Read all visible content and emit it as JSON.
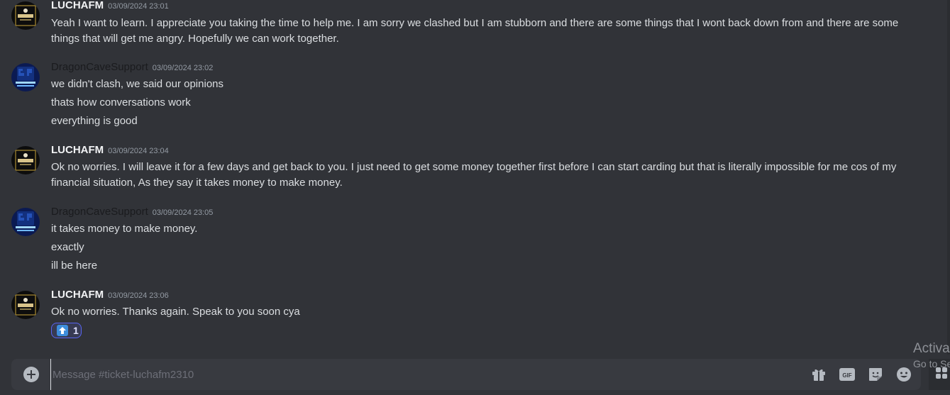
{
  "colors": {
    "background": "#313338",
    "username": "#f2f3f5",
    "support_username": "#1a1b1e",
    "timestamp": "#949ba4",
    "message_text": "#dbdee1",
    "reaction_border": "#5865f2",
    "composer_bg": "#383a40"
  },
  "messages": [
    {
      "author": "LUCHAFM",
      "avatar_icon": "luchafm-logo-avatar",
      "timestamp": "03/09/2024 23:01",
      "lines": [
        "Yeah I want to learn. I appreciate you taking the time to help me. I am sorry we clashed but I am stubborn and there are some things that I wont back down from and there are some things that will get me angry. Hopefully we can work together."
      ]
    },
    {
      "author": "DragonCaveSupport",
      "avatar_icon": "lockbit-ransomware-avatar",
      "timestamp": "03/09/2024 23:02",
      "lines": [
        "we didn't clash, we said our opinions",
        "thats how conversations work",
        "everything is good"
      ]
    },
    {
      "author": "LUCHAFM",
      "avatar_icon": "luchafm-logo-avatar",
      "timestamp": "03/09/2024 23:04",
      "lines": [
        "Ok no worries. I will leave it for a few days and get back to you.  I just need to get some money together first before I can start carding but that is literally impossible for me cos of my financial situation, As they say it takes money to make money."
      ]
    },
    {
      "author": "DragonCaveSupport",
      "avatar_icon": "lockbit-ransomware-avatar",
      "timestamp": "03/09/2024 23:05",
      "lines": [
        "it takes money to make money.",
        "exactly",
        "ill be here"
      ]
    },
    {
      "author": "LUCHAFM",
      "avatar_icon": "luchafm-logo-avatar",
      "timestamp": "03/09/2024 23:06",
      "lines": [
        "Ok no worries. Thanks again. Speak to you soon cya"
      ],
      "reaction": {
        "emoji_icon": "up-arrow-emoji-icon",
        "count": "1"
      }
    }
  ],
  "composer": {
    "placeholder": "Message #ticket-luchafm2310",
    "icons": [
      "add-attachment-icon",
      "gift-icon",
      "gif-icon",
      "sticker-icon",
      "emoji-icon"
    ],
    "gif_label": "GIF"
  },
  "watermark": {
    "line1": "Activa",
    "line2": "Go to Se"
  }
}
